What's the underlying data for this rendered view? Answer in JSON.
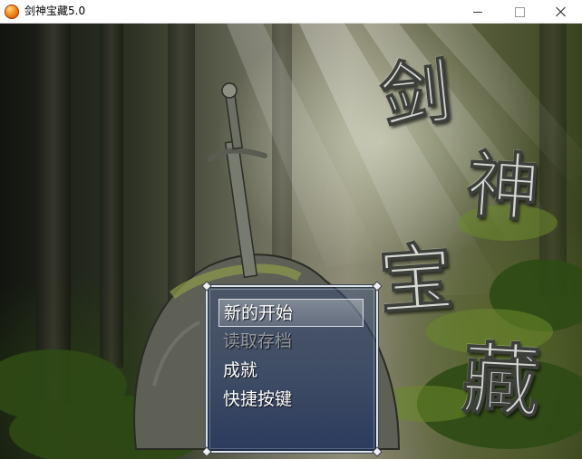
{
  "window": {
    "title": "剑神宝藏5.0",
    "icon": "app-orb-icon",
    "controls": [
      "minimize",
      "maximize",
      "close"
    ]
  },
  "game": {
    "logo_glyphs": [
      "剑",
      "神",
      "宝",
      "藏"
    ],
    "menu": {
      "items": [
        {
          "label": "新的开始",
          "state": "selected"
        },
        {
          "label": "读取存档",
          "state": "disabled"
        },
        {
          "label": "成就",
          "state": "normal"
        },
        {
          "label": "快捷按键",
          "state": "normal"
        }
      ]
    }
  },
  "colors": {
    "menu_bg": "#2d4270",
    "menu_border": "#dfe4ea",
    "disabled_text": "#9aa3b3"
  }
}
